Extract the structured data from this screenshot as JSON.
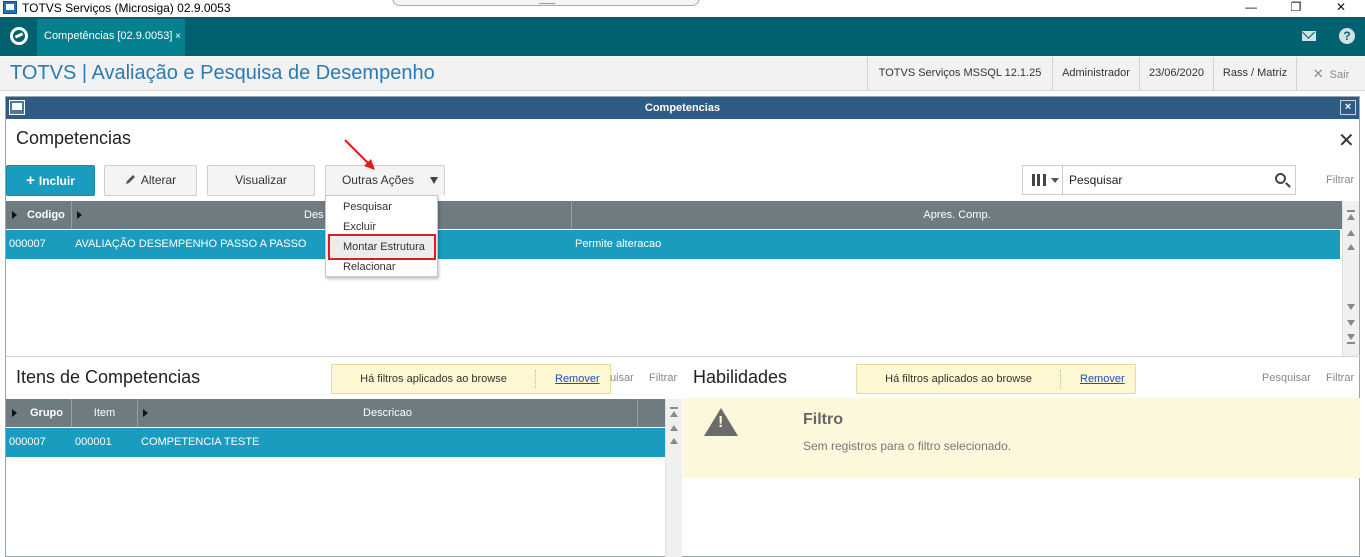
{
  "window": {
    "title": "TOTVS Serviços (Microsiga) 02.9.0053",
    "min": "—",
    "restore": "❐",
    "close": "✕"
  },
  "tabbar": {
    "tab_label": "Competências [02.9.0053]",
    "tab_close": "×",
    "help": "?"
  },
  "header": {
    "module_title": "TOTVS | Avaliação e Pesquisa de Desempenho",
    "environment": "TOTVS Serviços MSSQL 12.1.25",
    "user": "Administrador",
    "date": "23/06/2020",
    "branch": "Rass / Matriz",
    "exit": "Sair",
    "exit_icon": "✕"
  },
  "dialog": {
    "title": "Competencias",
    "close": "×"
  },
  "page": {
    "title": "Competencias",
    "close": "✕"
  },
  "toolbar": {
    "incluir": "Incluir",
    "incluir_icon": "+",
    "alterar": "Alterar",
    "visualizar": "Visualizar",
    "outras": "Outras Ações"
  },
  "menu": {
    "items": [
      "Pesquisar",
      "Excluir",
      "Montar Estrutura",
      "Relacionar"
    ],
    "highlighted": "Montar Estrutura"
  },
  "search": {
    "placeholder": "Pesquisar",
    "filter": "Filtrar"
  },
  "grid1": {
    "columns": [
      "Codigo",
      "Descricao",
      "Apres. Comp."
    ],
    "column_visible": [
      "Codigo",
      "Des",
      "Apres. Comp."
    ],
    "rows": [
      {
        "codigo": "000007",
        "descricao": "AVALIAÇÃO DESEMPENHO PASSO A PASSO",
        "apres": "Permite alteracao"
      }
    ]
  },
  "itens": {
    "title": "Itens de Competencias",
    "filter_msg": "Há filtros aplicados ao browse",
    "remove": "Remover",
    "search_partial": "uisar",
    "filter": "Filtrar",
    "columns": [
      "Grupo",
      "Item",
      "Descricao"
    ],
    "rows": [
      {
        "grupo": "000007",
        "item": "000001",
        "descricao": "COMPETENCIA TESTE"
      }
    ]
  },
  "habilidades": {
    "title": "Habilidades",
    "filter_msg": "Há filtros aplicados ao browse",
    "remove": "Remover",
    "search": "Pesquisar",
    "filter": "Filtrar",
    "empty_title": "Filtro",
    "empty_msg": "Sem registros para o filtro selecionado."
  },
  "colors": {
    "teal_dark": "#02616e",
    "tab_active": "#05808f",
    "accent_blue": "#1a9cbf",
    "dialog_bar": "#2e5c85",
    "grid_header": "#6e7c82",
    "notice_bg": "#fdf8d2",
    "annotation_red": "#e21a1a",
    "title_blue": "#2b7ab1"
  }
}
